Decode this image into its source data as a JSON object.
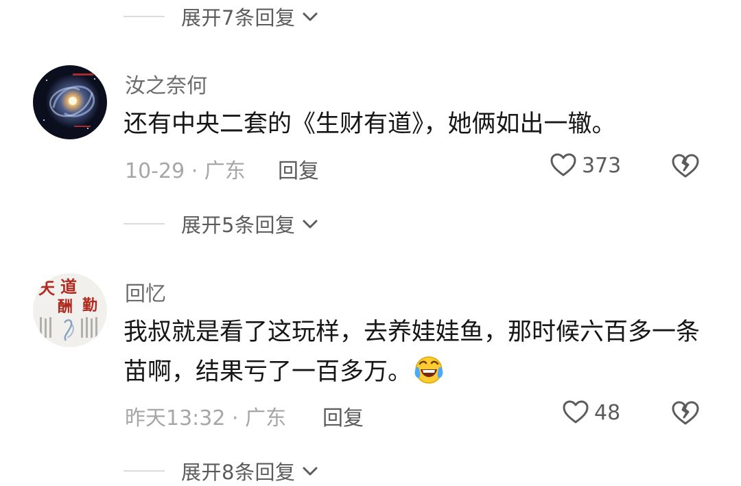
{
  "expand_rows": [
    {
      "label": "展开7条回复"
    },
    {
      "label": "展开5条回复"
    },
    {
      "label": "展开8条回复"
    }
  ],
  "comments": [
    {
      "username": "汝之奈何",
      "text": "还有中央二套的《生财有道》，她俩如出一辙。",
      "time_location": "10-29 · 广东",
      "reply_label": "回复",
      "likes": "373",
      "avatar_icon": "galaxy-avatar"
    },
    {
      "username": "回忆",
      "text": "我叔就是看了这玩样，去养娃娃鱼，那时候六百多一条苗啊，结果亏了一百多万。",
      "emoji": "laughing-crying-emoji",
      "time_location": "昨天13:32 · 广东",
      "reply_label": "回复",
      "likes": "48",
      "avatar_icon": "calligraphy-avatar",
      "avatar_text": [
        "天",
        "道",
        "酬",
        "勤"
      ]
    }
  ],
  "colors": {
    "text_primary": "#161616",
    "text_secondary": "#6b6b6b",
    "text_meta": "#a6a6a6",
    "divider": "#dcdcdc",
    "avatar_calligraphy_red": "#c0392b"
  }
}
